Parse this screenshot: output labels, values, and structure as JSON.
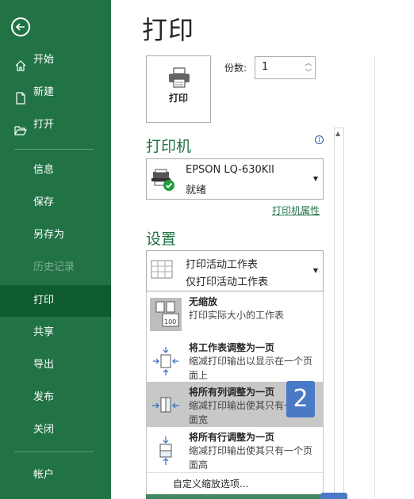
{
  "sidebar": {
    "items": [
      {
        "label": "开始",
        "icon": "home-icon"
      },
      {
        "label": "新建",
        "icon": "new-document-icon"
      },
      {
        "label": "打开",
        "icon": "open-folder-icon"
      },
      {
        "label": "信息"
      },
      {
        "label": "保存"
      },
      {
        "label": "另存为"
      },
      {
        "label": "历史记录",
        "disabled": true
      },
      {
        "label": "打印",
        "active": true
      },
      {
        "label": "共享"
      },
      {
        "label": "导出"
      },
      {
        "label": "发布"
      },
      {
        "label": "关闭"
      },
      {
        "label": "帐户"
      }
    ]
  },
  "main": {
    "title": "打印",
    "print_button_label": "打印",
    "copies_label": "份数:",
    "copies_value": "1"
  },
  "printer": {
    "section_title": "打印机",
    "name": "EPSON LQ-630KII",
    "status": "就绪",
    "properties_link": "打印机属性"
  },
  "settings": {
    "section_title": "设置",
    "scope_title": "打印活动工作表",
    "scope_desc": "仅打印活动工作表"
  },
  "scaling_menu": {
    "items": [
      {
        "title": "无缩放",
        "desc": "打印实际大小的工作表"
      },
      {
        "title": "将工作表调整为一页",
        "desc": "缩减打印输出以显示在一个页面上"
      },
      {
        "title": "将所有列调整为一页",
        "desc": "缩减打印输出使其只有一个页面宽",
        "selected": true
      },
      {
        "title": "将所有行调整为一页",
        "desc": "缩减打印输出使其只有一个页面高"
      }
    ],
    "custom_label": "自定义缩放选项..."
  },
  "badge": "2",
  "colors": {
    "accent": "#217346",
    "active_nav": "#0e5c30",
    "badge": "#4a7ac6"
  }
}
